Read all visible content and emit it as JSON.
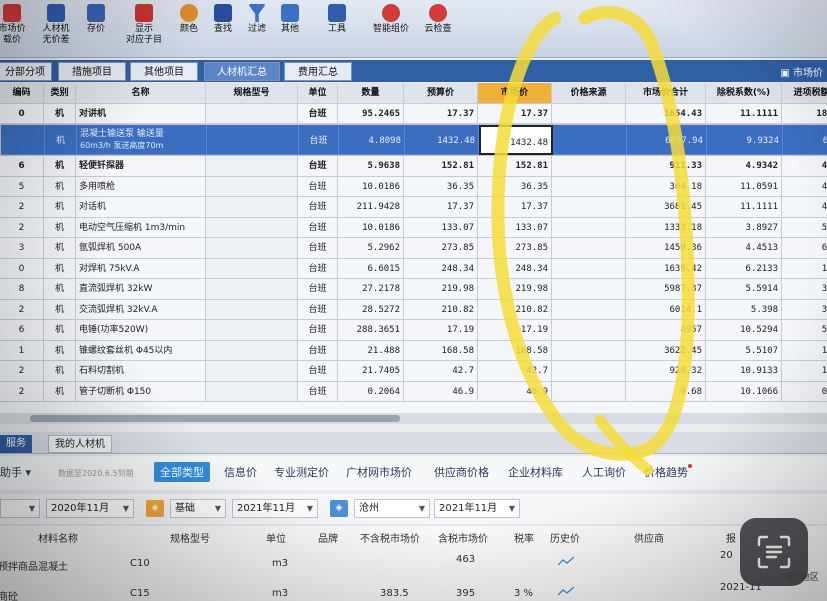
{
  "ribbon": {
    "buttons": [
      {
        "label": "市场价",
        "label2": "载价",
        "icon": "market-price-icon",
        "color": "#d63b3b"
      },
      {
        "label": "人材机",
        "label2": "无价差",
        "icon": "labor-material-icon",
        "color": "#2e5fb7"
      },
      {
        "label": "存价",
        "label2": "",
        "icon": "save-price-icon",
        "color": "#3a66b8"
      },
      {
        "label": "显示",
        "label2": "对应子目",
        "icon": "show-subitem-icon",
        "color": "#c33"
      },
      {
        "label": "颜色",
        "label2": "",
        "icon": "color-icon",
        "color": "#e0902a"
      },
      {
        "label": "查找",
        "label2": "",
        "icon": "find-icon",
        "color": "#2a4f9a"
      },
      {
        "label": "过滤",
        "label2": "",
        "icon": "filter-icon",
        "color": "#3a70c8"
      },
      {
        "label": "其他",
        "label2": "",
        "icon": "other-icon",
        "color": "#3d6fc4"
      },
      {
        "label": "工具",
        "label2": "",
        "icon": "tools-icon",
        "color": "#2f5ea8"
      },
      {
        "label": "智能组价",
        "label2": "",
        "icon": "smart-pricing-icon",
        "color": "#d33a3a"
      },
      {
        "label": "云检查",
        "label2": "",
        "icon": "cloud-check-icon",
        "color": "#d33a3a"
      }
    ]
  },
  "tabs": {
    "items": [
      "分部分项",
      "措施项目",
      "其他项目",
      "人材机汇总",
      "费用汇总"
    ],
    "active": "人材机汇总",
    "right_label": "市场价"
  },
  "grid": {
    "columns": [
      "编码",
      "类别",
      "名称",
      "规格型号",
      "单位",
      "数量",
      "预算价",
      "市场价",
      "价格来源",
      "市场价合计",
      "除税系数(%)",
      "进项税额"
    ],
    "rows": [
      {
        "code": "0",
        "type": "机",
        "name": "对讲机",
        "spec": "",
        "unit": "台班",
        "qty": "95.2465",
        "budget": "17.37",
        "market": "17.37",
        "source": "",
        "total": "1654.43",
        "tax": "11.1111",
        "input": "183.",
        "bold": true
      },
      {
        "code": "",
        "type": "机",
        "name": "混凝土输送泵 输送量",
        "name2": "60m3/h 泵送高度70m",
        "spec": "",
        "unit": "台班",
        "qty": "4.8098",
        "budget": "1432.48",
        "market": "1432.48",
        "source": "",
        "total": "6897.94",
        "tax": "9.9324",
        "input": "685",
        "sel": true
      },
      {
        "code": "6",
        "type": "机",
        "name": "轻便钎探器",
        "spec": "",
        "unit": "台班",
        "qty": "5.9638",
        "budget": "152.81",
        "market": "152.81",
        "source": "",
        "total": "911.33",
        "tax": "4.9342",
        "input": "44.",
        "bold": true
      },
      {
        "code": "5",
        "type": "机",
        "name": "多用喷枪",
        "spec": "",
        "unit": "台班",
        "qty": "10.0186",
        "budget": "36.35",
        "market": "36.35",
        "source": "",
        "total": "364.18",
        "tax": "11.0591",
        "input": "40."
      },
      {
        "code": "2",
        "type": "机",
        "name": "对话机",
        "spec": "",
        "unit": "台班",
        "qty": "211.9428",
        "budget": "17.37",
        "market": "17.37",
        "source": "",
        "total": "3681.45",
        "tax": "11.1111",
        "input": "409"
      },
      {
        "code": "2",
        "type": "机",
        "name": "电动空气压缩机 1m3/min",
        "spec": "",
        "unit": "台班",
        "qty": "10.0186",
        "budget": "133.07",
        "market": "133.07",
        "source": "",
        "total": "1333.18",
        "tax": "3.8927",
        "input": "51."
      },
      {
        "code": "3",
        "type": "机",
        "name": "氩弧焊机 500A",
        "spec": "",
        "unit": "台班",
        "qty": "5.2962",
        "budget": "273.85",
        "market": "273.85",
        "source": "",
        "total": "1450.36",
        "tax": "4.4513",
        "input": "64."
      },
      {
        "code": "0",
        "type": "机",
        "name": "对焊机 75kV.A",
        "spec": "",
        "unit": "台班",
        "qty": "6.6015",
        "budget": "248.34",
        "market": "248.34",
        "source": "",
        "total": "1639.42",
        "tax": "6.2133",
        "input": "101"
      },
      {
        "code": "8",
        "type": "机",
        "name": "直流弧焊机 32kW",
        "spec": "",
        "unit": "台班",
        "qty": "27.2178",
        "budget": "219.98",
        "market": "219.98",
        "source": "",
        "total": "5987.37",
        "tax": "5.5914",
        "input": "334"
      },
      {
        "code": "2",
        "type": "机",
        "name": "交流弧焊机 32kV.A",
        "spec": "",
        "unit": "台班",
        "qty": "28.5272",
        "budget": "210.82",
        "market": "210.82",
        "source": "",
        "total": "6014.1",
        "tax": "5.398",
        "input": "324"
      },
      {
        "code": "6",
        "type": "机",
        "name": "电锤(功率520W)",
        "spec": "",
        "unit": "台班",
        "qty": "288.3651",
        "budget": "17.19",
        "market": "17.19",
        "source": "",
        "total": "4957",
        "tax": "10.5294",
        "input": "521"
      },
      {
        "code": "1",
        "type": "机",
        "name": "锥螺纹套丝机 Φ45以内",
        "spec": "",
        "unit": "台班",
        "qty": "21.488",
        "budget": "168.58",
        "market": "168.58",
        "source": "",
        "total": "3622.45",
        "tax": "5.5107",
        "input": "199"
      },
      {
        "code": "2",
        "type": "机",
        "name": "石料切割机",
        "spec": "",
        "unit": "台班",
        "qty": "21.7405",
        "budget": "42.7",
        "market": "42.7",
        "source": "",
        "total": "928.32",
        "tax": "10.9133",
        "input": "101"
      },
      {
        "code": "2",
        "type": "机",
        "name": "管子切断机 Φ150",
        "spec": "",
        "unit": "台班",
        "qty": "0.2064",
        "budget": "46.9",
        "market": "46.9",
        "source": "",
        "total": "9.68",
        "tax": "10.1066",
        "input": "0.9"
      }
    ]
  },
  "panel": {
    "tabs": [
      "服务",
      "我的人材机"
    ],
    "assistant": "助手",
    "assistant_note": "数据至2020.6.5到期",
    "subtabs": [
      "全部类型",
      "信息价",
      "专业测定价",
      "广材网市场价",
      "供应商价格",
      "企业材料库",
      "人工询价",
      "价格趋势"
    ],
    "active_subtab": "全部类型"
  },
  "filters": {
    "period": "2020年11月",
    "base": "基础",
    "base_period": "2021年11月",
    "region": "沧州",
    "region_period": "2021年11月"
  },
  "btable": {
    "headers": [
      "材料名称",
      "规格型号",
      "单位",
      "品牌",
      "不含税市场价",
      "含税市场价",
      "税率",
      "历史价",
      "供应商",
      "报"
    ],
    "rows": [
      {
        "name": "预拌商品混凝土",
        "spec": "C10",
        "unit": "m3",
        "brand": "",
        "pretax": "",
        "taxed": "463",
        "rate": "",
        "supplier": "",
        "date": "20",
        "extra": ""
      },
      {
        "name": "商砼",
        "spec": "C15",
        "unit": "m3",
        "brand": "",
        "pretax": "383.5",
        "taxed": "395",
        "rate": "3 %",
        "supplier": "",
        "date": "2021-11",
        "extra": "存: 地区"
      }
    ]
  },
  "colors": {
    "highlight": "#f4dc3a",
    "selection": "#3b6ec1",
    "tab_bar": "#2f5fa4"
  }
}
